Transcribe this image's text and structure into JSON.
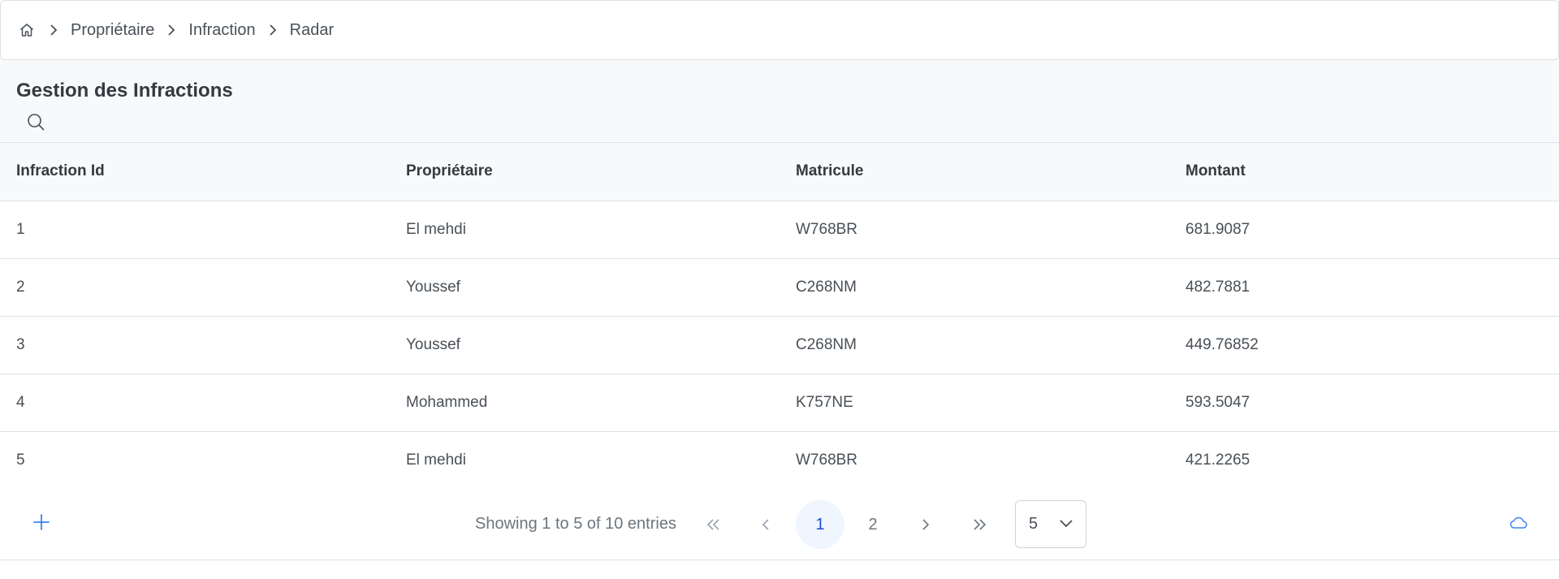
{
  "breadcrumb": {
    "home_icon": "home-icon",
    "separator_icon": "chevron-right-icon",
    "items": [
      "Propriétaire",
      "Infraction",
      "Radar"
    ]
  },
  "header": {
    "title": "Gestion des Infractions",
    "search_icon": "search-icon"
  },
  "table": {
    "columns": [
      "Infraction Id",
      "Propriétaire",
      "Matricule",
      "Montant"
    ],
    "rows": [
      [
        "1",
        "El mehdi",
        "W768BR",
        "681.9087"
      ],
      [
        "2",
        "Youssef",
        "C268NM",
        "482.7881"
      ],
      [
        "3",
        "Youssef",
        "C268NM",
        "449.76852"
      ],
      [
        "4",
        "Mohammed",
        "K757NE",
        "593.5047"
      ],
      [
        "5",
        "El mehdi",
        "W768BR",
        "421.2265"
      ]
    ]
  },
  "paginator": {
    "add_icon": "plus-icon",
    "report": "Showing 1 to 5 of 10 entries",
    "first_icon": "double-chevron-left-icon",
    "prev_icon": "chevron-left-icon",
    "pages": [
      "1",
      "2"
    ],
    "current_page": "1",
    "next_icon": "chevron-right-icon",
    "last_icon": "double-chevron-right-icon",
    "rows_per_page": "5",
    "dropdown_icon": "chevron-down-icon",
    "cloud_icon": "cloud-icon"
  },
  "colors": {
    "accent": "#3b82f6",
    "active_page_bg": "#eff6ff",
    "header_bg": "#f8f9fa",
    "border": "#dee2e6"
  }
}
